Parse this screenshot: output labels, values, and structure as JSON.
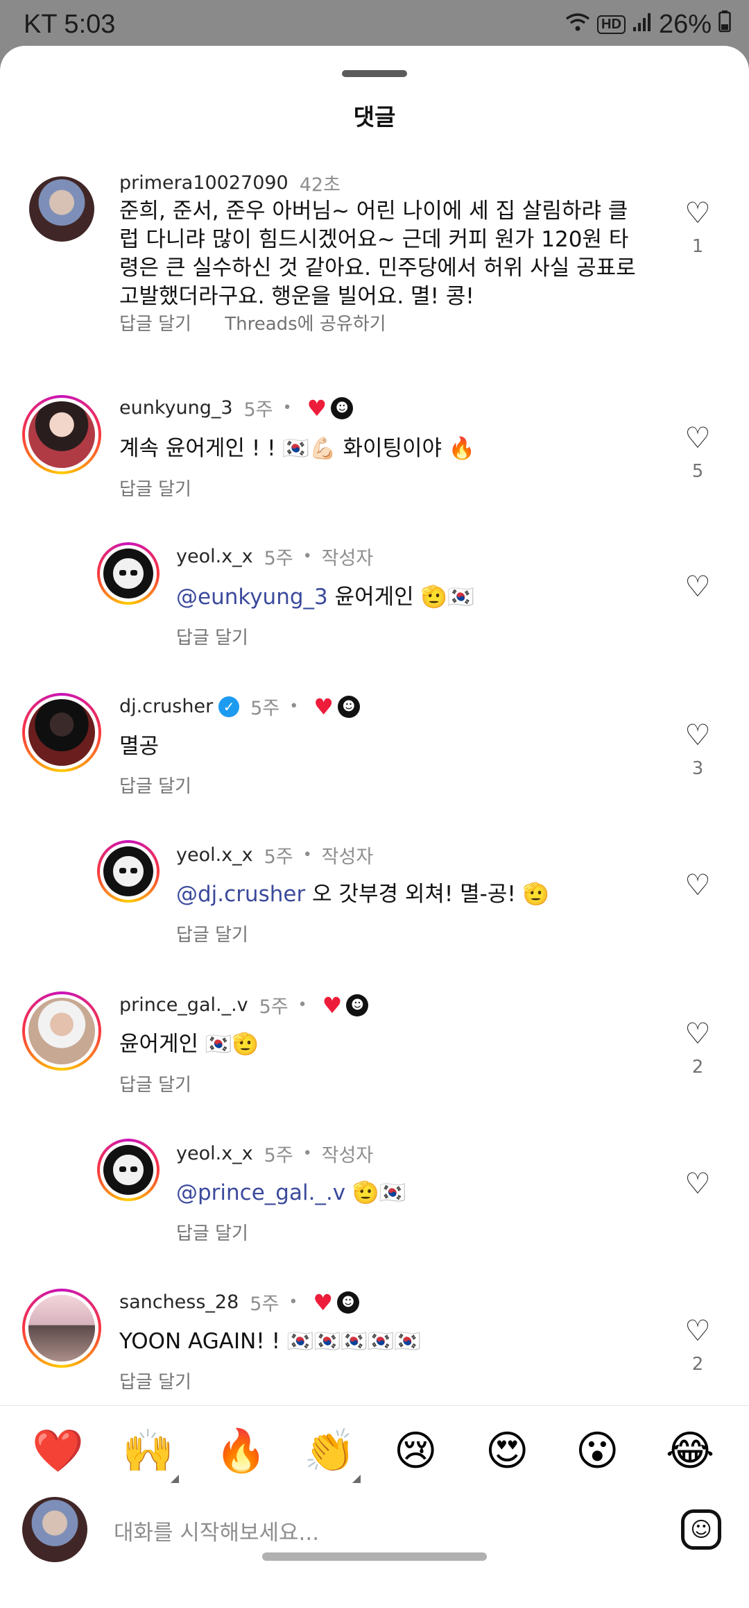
{
  "status": {
    "carrier_time": "KT 5:03",
    "battery": "26%",
    "net_label": "HD"
  },
  "sheet": {
    "title": "댓글"
  },
  "comments": [
    {
      "username": "primera10027090",
      "time": "42초",
      "text": "준희, 준서, 준우 아버님~ 어린 나이에 세 집 살림하랴 클럽 다니랴 많이 힘드시겠어요~ 근데 커피 원가 120원 타령은 큰 실수하신 것 같아요. 민주당에서 허위 사실 공표로 고발했더라구요. 행운을 빌어요. 멸! 콩!",
      "reply": "답글 달기",
      "share": "Threads에 공유하기",
      "likes": "1"
    },
    {
      "username": "eunkyung_3",
      "time": "5주",
      "dot": "•",
      "text": "계속 윤어게인 ! ! 🇰🇷💪🏻 화이팅이야 🔥",
      "reply": "답글 달기",
      "likes": "5"
    },
    {
      "username": "yeol.x_x",
      "time": "5주",
      "dot": "•",
      "author": "작성자",
      "mention": "@eunkyung_3",
      "text": " 윤어게인 🫡🇰🇷",
      "reply": "답글 달기"
    },
    {
      "username": "dj.crusher",
      "time": "5주",
      "dot": "•",
      "text": "멸공",
      "reply": "답글 달기",
      "likes": "3"
    },
    {
      "username": "yeol.x_x",
      "time": "5주",
      "dot": "•",
      "author": "작성자",
      "mention": "@dj.crusher",
      "text": " 오 갓부경 외쳐! 멸-공! 🫡",
      "reply": "답글 달기"
    },
    {
      "username": "prince_gal._.v",
      "time": "5주",
      "dot": "•",
      "text": "윤어게인 🇰🇷🫡",
      "reply": "답글 달기",
      "likes": "2"
    },
    {
      "username": "yeol.x_x",
      "time": "5주",
      "dot": "•",
      "author": "작성자",
      "mention": "@prince_gal._.v",
      "text": " 🫡🇰🇷",
      "reply": "답글 달기"
    },
    {
      "username": "sanchess_28",
      "time": "5주",
      "dot": "•",
      "text": "YOON AGAIN! ! 🇰🇷🇰🇷🇰🇷🇰🇷🇰🇷",
      "reply": "답글 달기",
      "likes": "2"
    }
  ],
  "emoji_bar": [
    "❤️",
    "🙌",
    "🔥",
    "👏",
    "😢",
    "😍",
    "😮",
    "😂"
  ],
  "composer": {
    "placeholder": "대화를 시작해보세요..."
  },
  "icons": {
    "like": "heart-outline-icon",
    "liked_by_author": "heart-filled-icon",
    "sticker": "sticker-icon"
  },
  "colors": {
    "mention": "#3b4a9c",
    "liked_red": "#ed1c3a",
    "verified_blue": "#1d9bf0"
  }
}
